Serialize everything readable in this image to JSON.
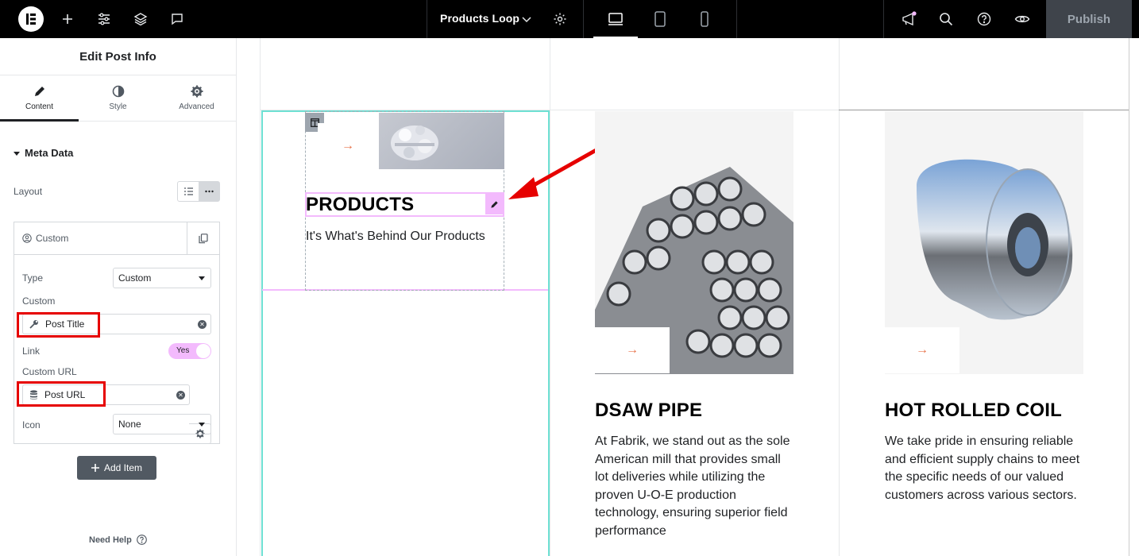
{
  "topbar": {
    "doc_title": "Products Loop",
    "publish_label": "Publish"
  },
  "panel": {
    "title": "Edit Post Info",
    "tabs": [
      {
        "label": "Content"
      },
      {
        "label": "Style"
      },
      {
        "label": "Advanced"
      }
    ],
    "section_title": "Meta Data",
    "layout_label": "Layout",
    "item": {
      "header": "Custom",
      "type_label": "Type",
      "type_value": "Custom",
      "custom_label": "Custom",
      "custom_tag": "Post Title",
      "link_label": "Link",
      "link_toggle": "Yes",
      "custom_url_label": "Custom URL",
      "custom_url_tag": "Post URL",
      "icon_label": "Icon",
      "icon_value": "None"
    },
    "add_item_label": "Add Item",
    "need_help": "Need Help"
  },
  "canvas": {
    "cards": [
      {
        "title": "PRODUCTS",
        "subtitle": "It's What's Behind Our Products"
      },
      {
        "title": "DSAW PIPE",
        "text": "At Fabrik, we stand out as the sole American mill that provides small lot deliveries while utilizing the proven U-O-E production technology, ensuring superior field performance"
      },
      {
        "title": "HOT ROLLED COIL",
        "text": "We take pride in ensuring reliable and efficient supply chains to meet the specific needs of our valued customers across various sectors."
      }
    ]
  },
  "colors": {
    "accent_pink": "#f3bafd",
    "annotation_red": "#e60000",
    "selection_teal": "#6ee0d3",
    "arrow_orange": "#e8734a"
  }
}
